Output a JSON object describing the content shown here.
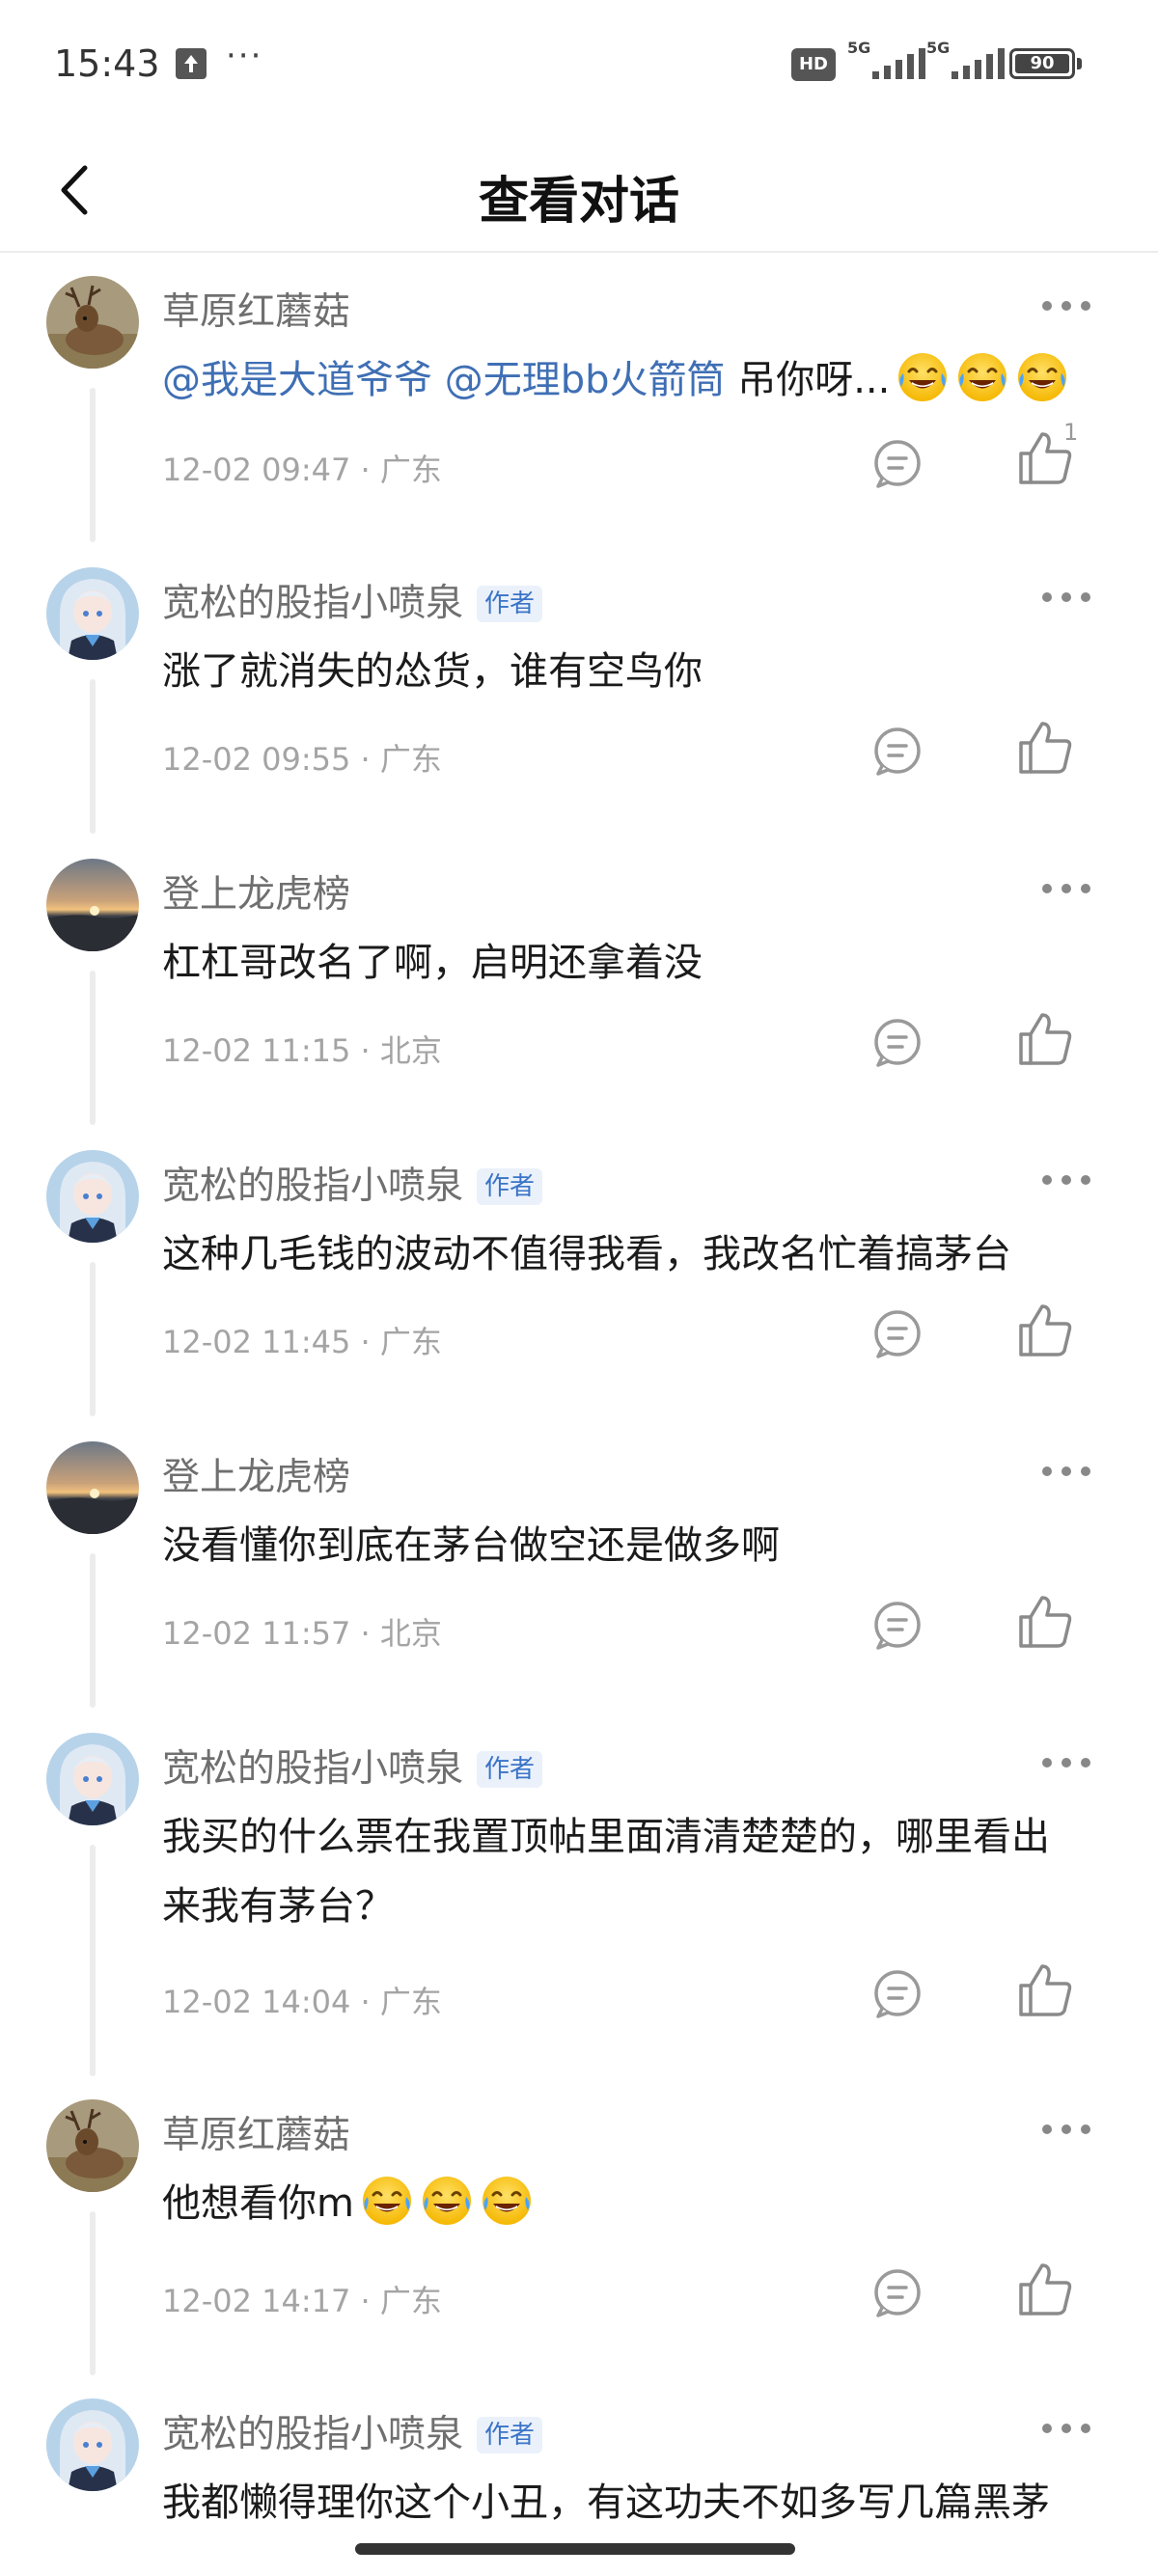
{
  "status_bar": {
    "time": "15:43",
    "more": "···",
    "hd_label": "HD",
    "network_1": "5G",
    "network_2": "5G",
    "battery": "90"
  },
  "header": {
    "title": "查看对话"
  },
  "comments": [
    {
      "author": "草原红蘑菇",
      "is_author": false,
      "mentions": [
        "@我是大道爷爷",
        "@无理bb火箭筒"
      ],
      "text": "吊你呀...",
      "emoji_count": 3,
      "time": "12-02 09:47 · 广东",
      "likes": "1",
      "avatar": "deer-avatar"
    },
    {
      "author": "宽松的股指小喷泉",
      "is_author": true,
      "author_badge": "作者",
      "text": "涨了就消失的怂货，谁有空鸟你",
      "time": "12-02 09:55 · 广东",
      "avatar": "anime-girl-avatar"
    },
    {
      "author": "登上龙虎榜",
      "is_author": false,
      "text": "杠杠哥改名了啊，启明还拿着没",
      "time": "12-02 11:15 · 北京",
      "avatar": "sunset-avatar"
    },
    {
      "author": "宽松的股指小喷泉",
      "is_author": true,
      "author_badge": "作者",
      "text": "这种几毛钱的波动不值得我看，我改名忙着搞茅台",
      "time": "12-02 11:45 · 广东",
      "avatar": "anime-girl-avatar"
    },
    {
      "author": "登上龙虎榜",
      "is_author": false,
      "text": "没看懂你到底在茅台做空还是做多啊",
      "time": "12-02 11:57 · 北京",
      "avatar": "sunset-avatar"
    },
    {
      "author": "宽松的股指小喷泉",
      "is_author": true,
      "author_badge": "作者",
      "text_line1": "我买的什么票在我置顶帖里面清清楚楚的，哪里看出",
      "text_line2": "来我有茅台？",
      "time": "12-02 14:04 · 广东",
      "avatar": "anime-girl-avatar"
    },
    {
      "author": "草原红蘑菇",
      "is_author": false,
      "text": "他想看你m",
      "emoji_count": 3,
      "time": "12-02 14:17 · 广东",
      "avatar": "deer-avatar"
    },
    {
      "author": "宽松的股指小喷泉",
      "is_author": true,
      "author_badge": "作者",
      "text": "我都懒得理你这个小丑，有这功夫不如多写几篇黑茅",
      "avatar": "anime-girl-avatar"
    }
  ]
}
